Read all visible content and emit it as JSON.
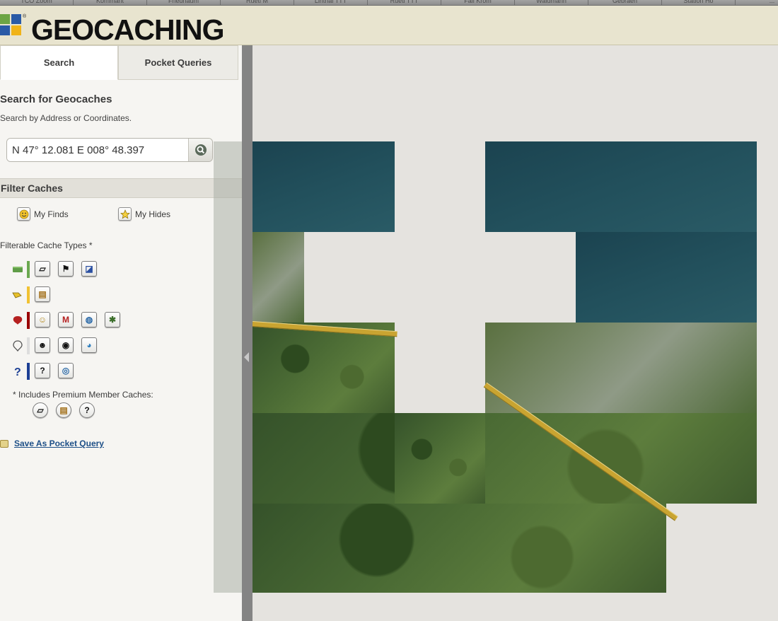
{
  "browser_tabs": [
    "TCO Zoom",
    "Kornmaht",
    "Friedhaum",
    "Rueti M",
    "Linthal TTT",
    "Rueti TTT",
    "Fall Krom",
    "Waldmann",
    "Gebraeh",
    "Station Ho",
    "..."
  ],
  "header": {
    "brand": "GEOCACHING",
    "registered_mark": "®"
  },
  "tabs": {
    "search": "Search",
    "pocket_queries": "Pocket Queries"
  },
  "search_section": {
    "title": "Search for Geocaches",
    "subtitle": "Search by Address or Coordinates.",
    "input_value": "N 47° 12.081 E 008° 48.397",
    "search_button_icon": "magnifier-icon"
  },
  "filter": {
    "title": "Filter Caches",
    "my_finds": "My Finds",
    "my_hides": "My Hides",
    "cache_types_label": "Filterable Cache Types *",
    "premium_note": "* Includes Premium Member Caches:",
    "save_link": "Save As Pocket Query"
  },
  "cache_rows": [
    {
      "group_icon": "traditional-group-icon",
      "bar_color": "#6aa84f",
      "items": [
        "traditional-icon",
        "multi-icon",
        "virtual-icon"
      ]
    },
    {
      "group_icon": "letterbox-group-icon",
      "bar_color": "#f1c232",
      "items": [
        "letterbox-icon"
      ]
    },
    {
      "group_icon": "event-group-icon",
      "bar_color": "#990000",
      "items": [
        "event-icon",
        "mega-event-icon",
        "cito-icon",
        "giga-icon"
      ]
    },
    {
      "group_icon": "earth-group-icon",
      "bar_color": "#dddddd",
      "items": [
        "webcam-icon",
        "earthcache-icon",
        "wherigo-icon"
      ]
    },
    {
      "group_icon": "mystery-group-icon",
      "bar_color": "#1c3f94",
      "items": [
        "mystery-icon",
        "lab-icon"
      ]
    }
  ],
  "colors": {
    "header_bg": "#e8e4cf",
    "panel_bg": "#f6f5f2",
    "link": "#1d4f87",
    "splitter": "#848484"
  }
}
